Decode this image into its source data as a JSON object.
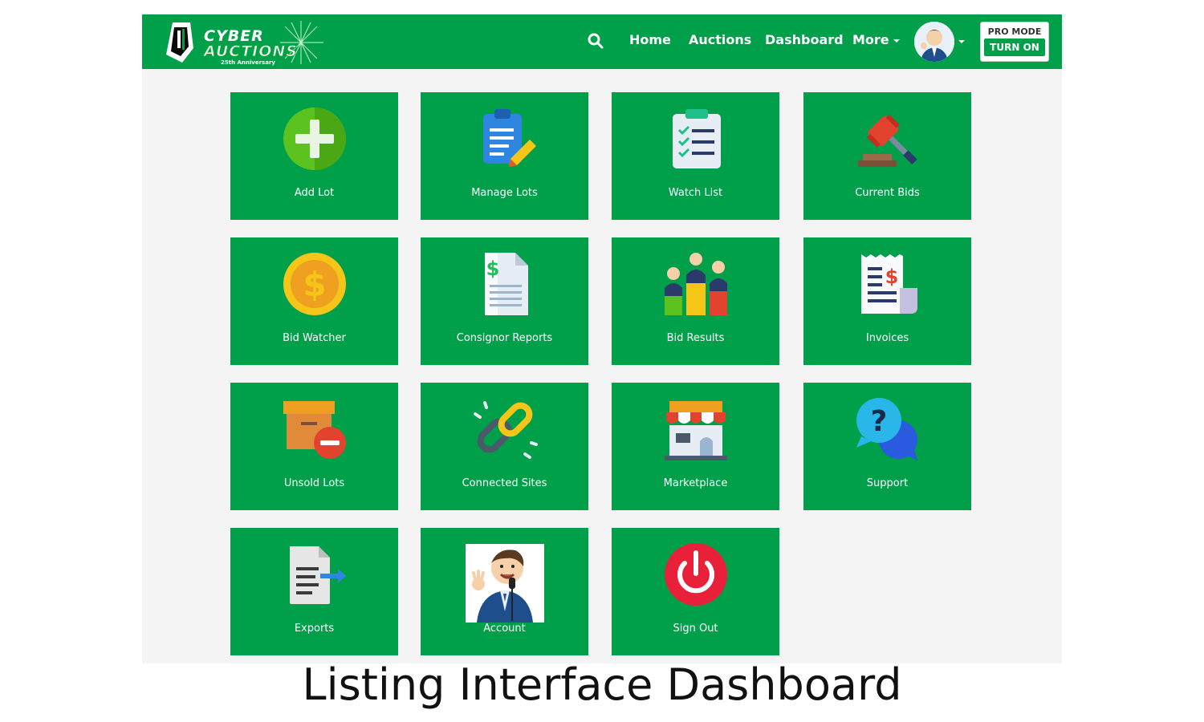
{
  "brand": {
    "name_line1": "CYBER",
    "name_line2": "AUCTIONS",
    "tagline": "25th Anniversary",
    "color": "#00a04a"
  },
  "nav": {
    "search_icon": "search-icon",
    "links": [
      "Home",
      "Auctions",
      "Dashboard",
      "More"
    ],
    "pro_mode_label": "PRO MODE",
    "pro_mode_button": "TURN ON"
  },
  "tiles": [
    {
      "label": "Add Lot",
      "icon": "add-icon"
    },
    {
      "label": "Manage Lots",
      "icon": "clipboard-pencil-icon"
    },
    {
      "label": "Watch List",
      "icon": "checklist-icon"
    },
    {
      "label": "Current Bids",
      "icon": "gavel-icon"
    },
    {
      "label": "Bid Watcher",
      "icon": "dollar-coin-icon"
    },
    {
      "label": "Consignor Reports",
      "icon": "dollar-report-icon"
    },
    {
      "label": "Bid Results",
      "icon": "people-podium-icon"
    },
    {
      "label": "Invoices",
      "icon": "invoice-receipt-icon"
    },
    {
      "label": "Unsold Lots",
      "icon": "box-minus-icon"
    },
    {
      "label": "Connected Sites",
      "icon": "chain-link-icon"
    },
    {
      "label": "Marketplace",
      "icon": "storefront-icon"
    },
    {
      "label": "Support",
      "icon": "question-chat-icon"
    },
    {
      "label": "Exports",
      "icon": "file-export-icon"
    },
    {
      "label": "Account",
      "icon": "auctioneer-avatar-icon"
    },
    {
      "label": "Sign Out",
      "icon": "power-icon"
    }
  ],
  "caption": "Listing Interface Dashboard"
}
